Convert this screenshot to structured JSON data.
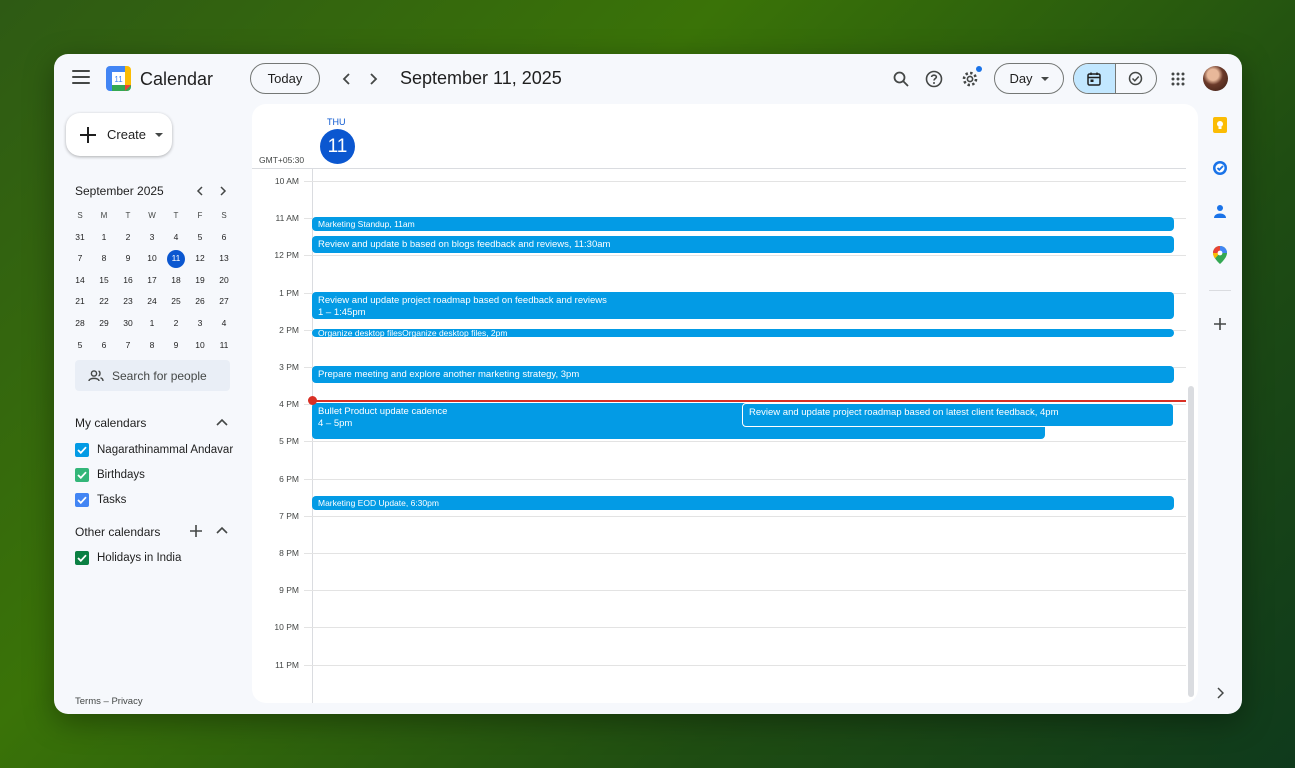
{
  "app": {
    "title": "Calendar",
    "logo_day": "11"
  },
  "header": {
    "today_label": "Today",
    "current_date": "September 11, 2025",
    "view_label": "Day"
  },
  "sidebar": {
    "create_label": "Create",
    "mini_cal": {
      "title": "September 2025",
      "dow": [
        "S",
        "M",
        "T",
        "W",
        "T",
        "F",
        "S"
      ],
      "weeks": [
        [
          "31",
          "1",
          "2",
          "3",
          "4",
          "5",
          "6"
        ],
        [
          "7",
          "8",
          "9",
          "10",
          "11",
          "12",
          "13"
        ],
        [
          "14",
          "15",
          "16",
          "17",
          "18",
          "19",
          "20"
        ],
        [
          "21",
          "22",
          "23",
          "24",
          "25",
          "26",
          "27"
        ],
        [
          "28",
          "29",
          "30",
          "1",
          "2",
          "3",
          "4"
        ],
        [
          "5",
          "6",
          "7",
          "8",
          "9",
          "10",
          "11"
        ]
      ],
      "selected": "11"
    },
    "search_people_placeholder": "Search for people",
    "my_calendars_title": "My calendars",
    "my_calendars": [
      {
        "label": "Nagarathinammal Andavar",
        "color": "#039be5"
      },
      {
        "label": "Birthdays",
        "color": "#33b679"
      },
      {
        "label": "Tasks",
        "color": "#4285f4"
      }
    ],
    "other_calendars_title": "Other calendars",
    "other_calendars": [
      {
        "label": "Holidays in India",
        "color": "#0b8043"
      }
    ],
    "footer": {
      "terms": "Terms",
      "sep": " – ",
      "privacy": "Privacy"
    }
  },
  "day_view": {
    "dow": "THU",
    "day_num": "11",
    "timezone": "GMT+05:30",
    "hours": [
      "10 AM",
      "11 AM",
      "12 PM",
      "1 PM",
      "2 PM",
      "3 PM",
      "4 PM",
      "5 PM",
      "6 PM",
      "7 PM",
      "8 PM",
      "9 PM",
      "10 PM",
      "11 PM"
    ],
    "events": [
      {
        "title": "Marketing Standup",
        "time": ", 11am"
      },
      {
        "title": "Review and update b based on blogs feedback and reviews",
        "time": ", 11:30am"
      },
      {
        "title": "Review and update project roadmap based on feedback and reviews",
        "time": "1 – 1:45pm"
      },
      {
        "title": "Organize desktop filesOrganize desktop files",
        "time": ", 2pm"
      },
      {
        "title": "Prepare meeting and explore another marketing strategy",
        "time": ", 3pm"
      },
      {
        "title": "Bullet Product update cadence",
        "time": "4 – 5pm"
      },
      {
        "title": "Review and update project roadmap based on latest client feedback",
        "time": ", 4pm"
      },
      {
        "title": "Marketing EOD Update",
        "time": ", 6:30pm"
      }
    ]
  },
  "colors": {
    "event": "#039be5",
    "accent": "#0b57d0",
    "now": "#d93025"
  },
  "right_panel_icons": [
    "keep-icon",
    "tasks-icon",
    "contacts-icon",
    "maps-icon",
    "add-icon",
    "chevron-right-icon"
  ]
}
